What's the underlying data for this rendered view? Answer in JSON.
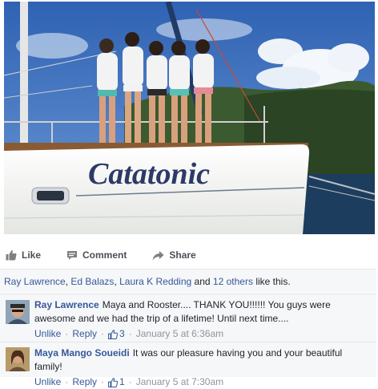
{
  "photo": {
    "boat_name": "Catatonic",
    "colors": {
      "sky": "#4a7bc6",
      "hull": "#f4f5f2",
      "hull_text": "#2c3a66",
      "deck": "#8a5b33",
      "water": "#1d3d5e",
      "hill": "#2f4a2a"
    }
  },
  "actions": {
    "like": "Like",
    "comment": "Comment",
    "share": "Share"
  },
  "likes": {
    "name1": "Ray Lawrence",
    "sep1": ",",
    "name2": "Ed Balazs",
    "sep2": ",",
    "name3": "Laura K Redding",
    "and": "and",
    "others": "12 others",
    "suffix": "like this."
  },
  "comments": [
    {
      "author": "Ray Lawrence",
      "text": "Maya and Rooster.... THANK YOU!!!!!! You guys were awesome and we had the trip of a lifetime! Until next time....",
      "unlike": "Unlike",
      "reply": "Reply",
      "like_count": "3",
      "timestamp": "January 5 at 6:36am"
    },
    {
      "author": "Maya Mango Soueidi",
      "text": "It was our pleasure having you and your beautiful family!",
      "unlike": "Unlike",
      "reply": "Reply",
      "like_count": "1",
      "timestamp": "January 5 at 7:30am"
    }
  ]
}
